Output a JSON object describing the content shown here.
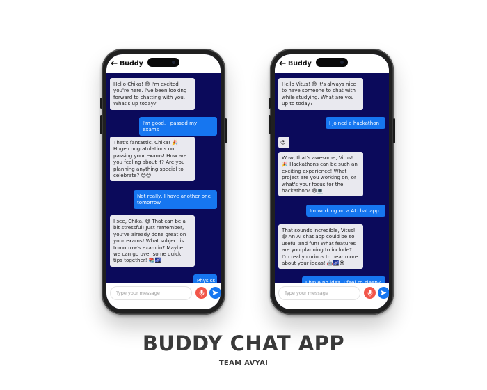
{
  "left_phone": {
    "title": "Buddy",
    "messages": [
      {
        "from": "bot",
        "text": "Hello Chika! 😊 I'm excited you're here. I've been looking forward to chatting with you. What's up today?"
      },
      {
        "from": "user",
        "text": "I'm good, I passed my exams"
      },
      {
        "from": "bot",
        "text": "That's fantastic, Chika! 🎉 Huge congratulations on passing your exams! How are you feeling about it? Are you planning anything special to celebrate? 😊😊"
      },
      {
        "from": "user",
        "text": "Not really, I have another one tomorrow"
      },
      {
        "from": "bot",
        "text": "I see, Chika. 😅 That can be a bit stressful! Just remember, you've already done great on your exams! What subject is tomorrow's exam in? Maybe we can go over some quick tips together! 📚🌌"
      },
      {
        "from": "user",
        "text": "Physics"
      }
    ],
    "input_placeholder": "Type your message"
  },
  "right_phone": {
    "title": "Buddy",
    "messages": [
      {
        "from": "bot",
        "text": "Hello Vitus! 😊 It's always nice to have someone to chat with while studying. What are you up to today?"
      },
      {
        "from": "user",
        "text": "I joined a hackathon"
      },
      {
        "from": "bot",
        "text": "😍"
      },
      {
        "from": "bot",
        "text": "Wow, that's awesome, Vitus! 🎉 Hackathons can be such an exciting experience! What project are you working on, or what's your focus for the hackathon? 😄💻"
      },
      {
        "from": "user",
        "text": "Im working on a AI chat app"
      },
      {
        "from": "bot",
        "text": "That sounds incredible, Vitus! 😄 An AI chat app could be so useful and fun! What features are you planning to include? I'm really curious to hear more about your ideas! 🤖🌌😍"
      },
      {
        "from": "user",
        "text": "I have no idea. I feel so sleepy right now. I haven't slept for"
      }
    ],
    "input_placeholder": "Type your message"
  },
  "footer": {
    "heading": "BUDDY CHAT APP",
    "subheading": "TEAM AVYAI"
  },
  "colors": {
    "chat_background": "#0b0a5b",
    "user_bubble": "#1676f0",
    "bot_bubble": "#e9e9ef",
    "mic_button": "#f2564a",
    "send_button": "#1676f0"
  },
  "icons": {
    "back": "arrow-left-icon",
    "mic": "microphone-icon",
    "send": "paper-plane-icon"
  }
}
